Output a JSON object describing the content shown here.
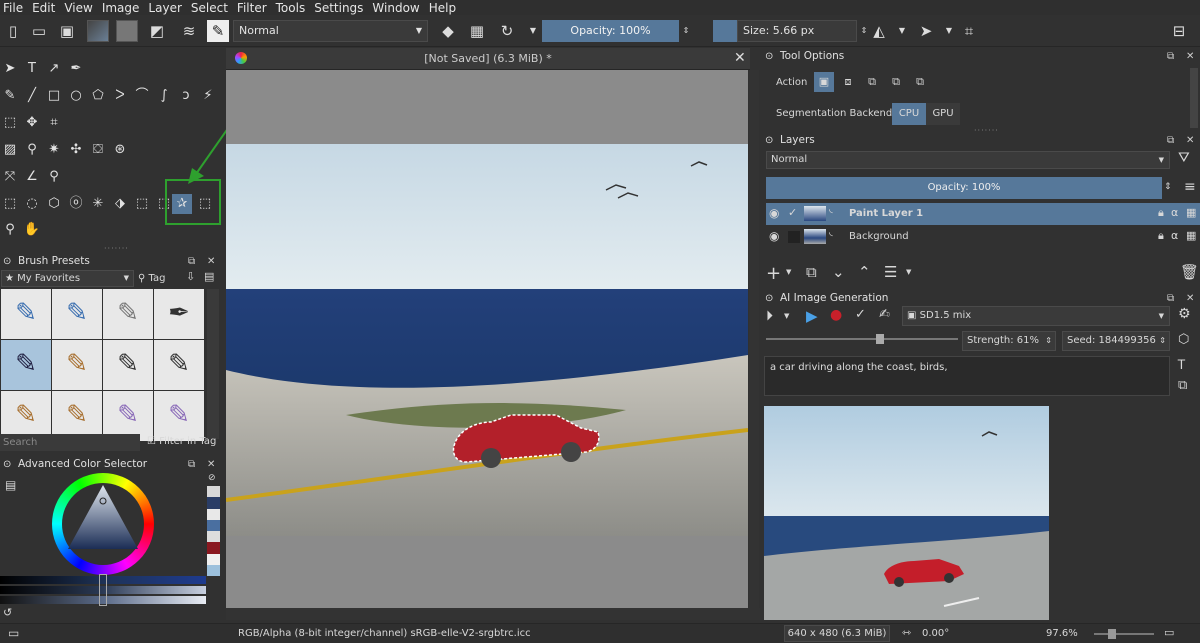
{
  "menu": [
    "File",
    "Edit",
    "View",
    "Image",
    "Layer",
    "Select",
    "Filter",
    "Tools",
    "Settings",
    "Window",
    "Help"
  ],
  "toolbar": {
    "blend_mode": "Normal",
    "opacity": "Opacity: 100%",
    "size": "Size: 5.66 px"
  },
  "document": {
    "title": "[Not Saved]  (6.3 MiB) *"
  },
  "brush_presets": {
    "title": "Brush Presets",
    "filter": "★ My Favorites",
    "tag": "Tag",
    "search_placeholder": "Search",
    "filter_in_tag": "Filter in Tag"
  },
  "color_selector": {
    "title": "Advanced Color Selector"
  },
  "tool_options": {
    "title": "Tool Options",
    "action_label": "Action",
    "segmentation_label": "Segmentation Backend",
    "cpu": "CPU",
    "gpu": "GPU"
  },
  "layers": {
    "title": "Layers",
    "blend_mode": "Normal",
    "opacity": "Opacity:  100%",
    "items": [
      {
        "name": "Paint Layer 1",
        "selected": true
      },
      {
        "name": "Background",
        "selected": false
      }
    ]
  },
  "ai": {
    "title": "AI Image Generation",
    "model": "SD1.5 mix",
    "strength": "Strength: 61%",
    "seed": "Seed: 184499356",
    "prompt": "a car driving along the coast, birds,"
  },
  "status": {
    "color_space": "RGB/Alpha (8-bit integer/channel)  sRGB-elle-V2-srgbtrc.icc",
    "dimensions": "640 x 480 (6.3 MiB)",
    "rotation": "0.00°",
    "zoom": "97.6%"
  },
  "colors": {
    "accent": "#56789a",
    "highlight_box": "#2ea02e"
  }
}
